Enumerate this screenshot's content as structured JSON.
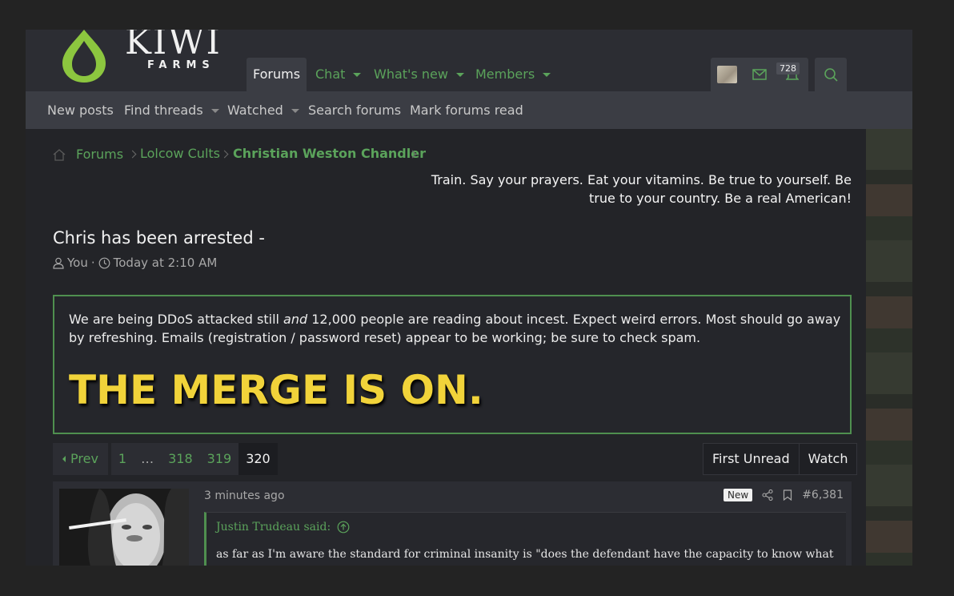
{
  "brand": {
    "title": "KIWI",
    "subtitle": "FARMS",
    "accent": "#5ba35b"
  },
  "nav": {
    "tabs": [
      {
        "label": "Forums",
        "active": true
      },
      {
        "label": "Chat",
        "active": false
      },
      {
        "label": "What's new",
        "active": false
      },
      {
        "label": "Members",
        "active": false
      }
    ],
    "alerts_count": "728",
    "icons": [
      "avatar",
      "envelope-icon",
      "bell-icon",
      "search-icon"
    ]
  },
  "subnav": {
    "items": [
      "New posts",
      "Find threads",
      "Watched",
      "Search forums",
      "Mark forums read"
    ]
  },
  "breadcrumb": [
    "Forums",
    "Lolcow Cults",
    "Christian Weston Chandler"
  ],
  "tagline": "Train. Say your prayers. Eat your vitamins. Be true to yourself. Be true to your country. Be a real American!",
  "thread": {
    "title": "Chris has been arrested -",
    "author": "You",
    "separator": "·",
    "time": "Today at 2:10 AM"
  },
  "notice": {
    "text_before": "We are being DDoS attacked still ",
    "text_emph": "and",
    "text_after": " 12,000 people are reading about incest. Expect weird errors. Most should go away by refreshing. Emails (registration / password reset) appear to be working; be sure to check spam.",
    "headline": "THE MERGE IS ON.",
    "headline_color": "#f1d33a"
  },
  "pager": {
    "prev": "Prev",
    "pages": [
      "1",
      "…",
      "318",
      "319",
      "320"
    ],
    "current": "320"
  },
  "thread_actions": [
    "First Unread",
    "Watch"
  ],
  "post": {
    "time": "3 minutes ago",
    "new_label": "New",
    "number": "#6,381",
    "quote_author": "Justin Trudeau said:",
    "quote_text": "as far as I'm aware the standard for criminal insanity is \"does the defendant have the capacity to know what"
  }
}
